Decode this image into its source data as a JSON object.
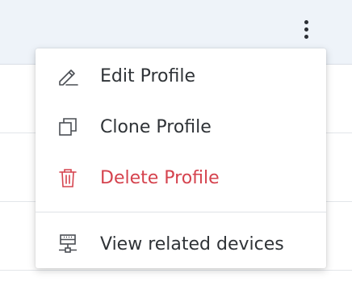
{
  "header": {
    "more_icon": "vertical-ellipsis-icon"
  },
  "context_menu": {
    "items": [
      {
        "label": "Edit Profile",
        "icon": "pencil-icon"
      },
      {
        "label": "Clone Profile",
        "icon": "copy-icon"
      },
      {
        "label": "Delete Profile",
        "icon": "trash-icon",
        "color": "#d5434e"
      },
      {
        "label": "View related devices",
        "icon": "devices-network-icon"
      }
    ]
  },
  "colors": {
    "header_background": "#eef3f9",
    "danger": "#d5434e",
    "text": "#2f3337",
    "icon": "#4a4e54"
  }
}
